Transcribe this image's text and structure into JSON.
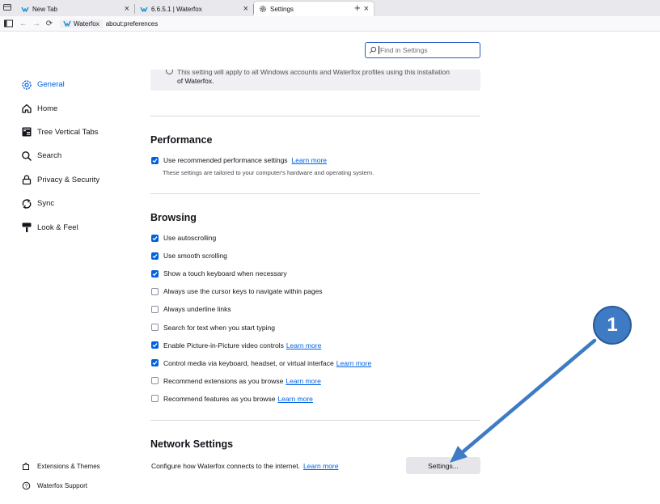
{
  "tabs": [
    {
      "title": "New Tab"
    },
    {
      "title": "6.6.5.1 | Waterfox"
    },
    {
      "title": "Settings"
    }
  ],
  "tab_close_glyph": "×",
  "new_tab_glyph": "+",
  "urlbar": {
    "site": "Waterfox",
    "url": "about:preferences"
  },
  "search": {
    "placeholder": "Find in Settings"
  },
  "sidebar": {
    "items": [
      {
        "label": "General",
        "icon": "gear-icon"
      },
      {
        "label": "Home",
        "icon": "home-icon"
      },
      {
        "label": "Tree Vertical Tabs",
        "icon": "tree-tabs-icon"
      },
      {
        "label": "Search",
        "icon": "search-icon"
      },
      {
        "label": "Privacy & Security",
        "icon": "lock-icon"
      },
      {
        "label": "Sync",
        "icon": "sync-icon"
      },
      {
        "label": "Look & Feel",
        "icon": "paint-roller-icon"
      }
    ],
    "extensions": "Extensions & Themes",
    "support": "Waterfox Support"
  },
  "notice": {
    "line1": "This setting will apply to all Windows accounts and Waterfox profiles using this installation",
    "line2": "of Waterfox."
  },
  "performance": {
    "title": "Performance",
    "option": "Use recommended performance settings",
    "learn_more": "Learn more",
    "hint": "These settings are tailored to your computer's hardware and operating system."
  },
  "browsing": {
    "title": "Browsing",
    "options": [
      {
        "label": "Use autoscrolling",
        "checked": true,
        "link": ""
      },
      {
        "label": "Use smooth scrolling",
        "checked": true,
        "link": ""
      },
      {
        "label": "Show a touch keyboard when necessary",
        "checked": true,
        "link": ""
      },
      {
        "label": "Always use the cursor keys to navigate within pages",
        "checked": false,
        "link": ""
      },
      {
        "label": "Always underline links",
        "checked": false,
        "link": ""
      },
      {
        "label": "Search for text when you start typing",
        "checked": false,
        "link": ""
      },
      {
        "label": "Enable Picture-in-Picture video controls",
        "checked": true,
        "link": "Learn more"
      },
      {
        "label": "Control media via keyboard, headset, or virtual interface",
        "checked": true,
        "link": "Learn more"
      },
      {
        "label": "Recommend extensions as you browse",
        "checked": false,
        "link": "Learn more"
      },
      {
        "label": "Recommend features as you browse",
        "checked": false,
        "link": "Learn more"
      }
    ]
  },
  "network": {
    "title": "Network Settings",
    "description": "Configure how Waterfox connects to the internet.",
    "learn_more": "Learn more",
    "button": "Settings..."
  },
  "annotation": {
    "label": "1",
    "color": "#3e7bc4"
  },
  "colors": {
    "accent": "#0061e0",
    "focus_border": "#2b5dc0"
  }
}
